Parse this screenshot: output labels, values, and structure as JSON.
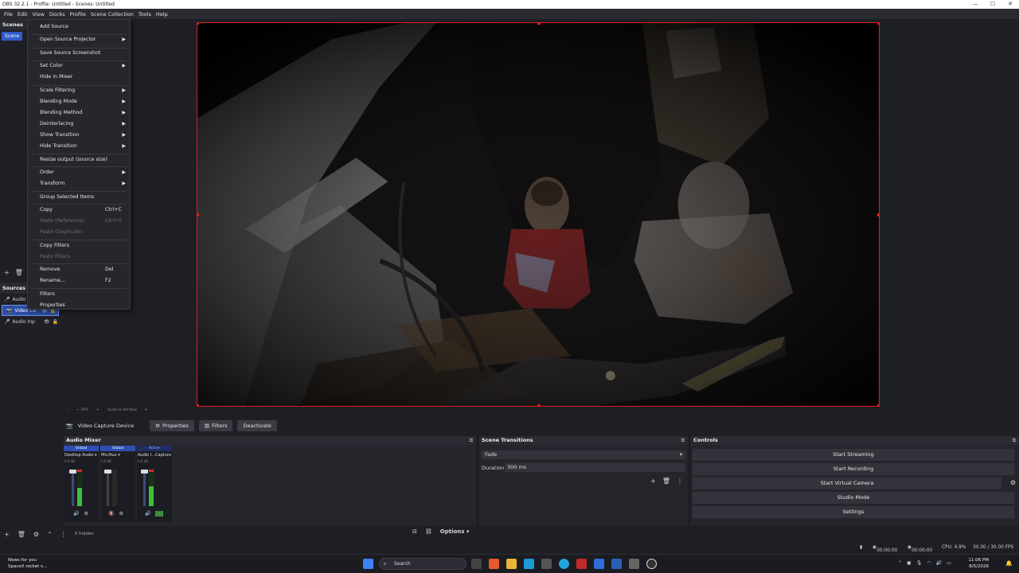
{
  "window": {
    "title": "OBS 32.2.1 - Profile: Untitled - Scenes: Untitled",
    "controls": [
      "—",
      "☐",
      "✕"
    ]
  },
  "menubar": [
    "File",
    "Edit",
    "View",
    "Docks",
    "Profile",
    "Scene Collection",
    "Tools",
    "Help"
  ],
  "scenes_dock": {
    "title": "Scenes",
    "items": [
      "Scene"
    ]
  },
  "sources_dock": {
    "title": "Sources",
    "items": [
      "Audio",
      "Video Ca",
      "Audio Inp"
    ],
    "hidden_count": "0 hidden"
  },
  "context_menu": {
    "items": [
      {
        "label": "Add Source",
        "submenu": false,
        "disabled": false
      },
      {
        "label": "Open Source Projector",
        "submenu": true,
        "disabled": false
      },
      {
        "label": "Save Source Screenshot",
        "submenu": false,
        "disabled": false
      },
      {
        "label": "Set Color",
        "submenu": true,
        "disabled": false
      },
      {
        "label": "Hide in Mixer",
        "submenu": false,
        "disabled": false
      },
      {
        "label": "Scale Filtering",
        "submenu": true,
        "disabled": false
      },
      {
        "label": "Blending Mode",
        "submenu": true,
        "disabled": false
      },
      {
        "label": "Blending Method",
        "submenu": true,
        "disabled": false
      },
      {
        "label": "Deinterlacing",
        "submenu": true,
        "disabled": false
      },
      {
        "label": "Show Transition",
        "submenu": true,
        "disabled": false
      },
      {
        "label": "Hide Transition",
        "submenu": true,
        "disabled": false
      },
      {
        "label": "Resize output (source size)",
        "submenu": false,
        "disabled": false
      },
      {
        "label": "Order",
        "submenu": true,
        "disabled": false
      },
      {
        "label": "Transform",
        "submenu": true,
        "disabled": false
      },
      {
        "label": "Group Selected Items",
        "submenu": false,
        "disabled": false
      },
      {
        "label": "Copy",
        "shortcut": "Ctrl+C",
        "submenu": false,
        "disabled": false
      },
      {
        "label": "Paste (Reference)",
        "shortcut": "Ctrl+V",
        "submenu": false,
        "disabled": true
      },
      {
        "label": "Paste (Duplicate)",
        "submenu": false,
        "disabled": true
      },
      {
        "label": "Copy Filters",
        "submenu": false,
        "disabled": false
      },
      {
        "label": "Paste Filters",
        "submenu": false,
        "disabled": true
      },
      {
        "label": "Remove",
        "shortcut": "Del",
        "submenu": false,
        "disabled": false
      },
      {
        "label": "Rename...",
        "shortcut": "F2",
        "submenu": false,
        "disabled": false
      },
      {
        "label": "Filters",
        "submenu": false,
        "disabled": false
      },
      {
        "label": "Properties",
        "submenu": false,
        "disabled": false
      }
    ]
  },
  "source_toolbar": {
    "label": "Video Capture Device",
    "properties": "Properties",
    "filters": "Filters",
    "deactivate": "Deactivate"
  },
  "preview_zoom": {
    "zoom": "~ 78%",
    "mode": "Scale to Window"
  },
  "audio_mixer": {
    "title": "Audio Mixer",
    "channels": [
      {
        "badge": "Global",
        "name": "Desktop Audio",
        "db": "0.0 dB",
        "level": 0.55
      },
      {
        "badge": "Global",
        "name": "Mic/Aux",
        "db": "0.0 dB",
        "level": 0.0
      },
      {
        "badge": "Active",
        "name": "Audio I...Capture",
        "db": "0.0 dB",
        "level": 0.6
      }
    ],
    "options_label": "Options"
  },
  "scene_transitions": {
    "title": "Scene Transitions",
    "transition": "Fade",
    "duration_label": "Duration",
    "duration_value": "300 ms"
  },
  "controls": {
    "title": "Controls",
    "buttons": [
      "Start Streaming",
      "Start Recording",
      "Start Virtual Camera",
      "Studio Mode",
      "Settings"
    ]
  },
  "status": {
    "time1": "00:00:00",
    "time2": "00:00:00",
    "cpu": "CPU: 4.9%",
    "fps": "30.00 / 30.00 FPS"
  },
  "taskbar": {
    "news_title": "News for you",
    "news_sub": "SpaceX rocket s...",
    "search_placeholder": "Search",
    "time": "11:06 PM",
    "date": "8/5/2026"
  },
  "colors": {
    "accent": "#2f5bc8",
    "selection_border": "#e01c1c",
    "meter_green": "#3ac13a",
    "meter_red": "#d42a2a"
  }
}
